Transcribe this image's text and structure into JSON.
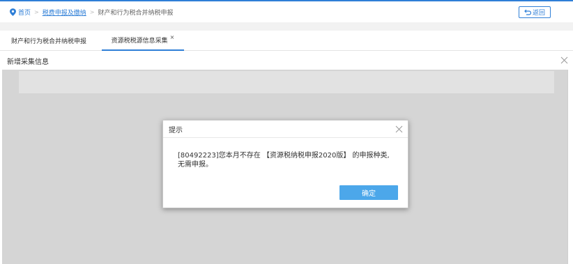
{
  "breadcrumb": {
    "home": "首页",
    "link": "税费申报及缴纳",
    "current": "财产和行为税合并纳税申报",
    "separator": ">"
  },
  "back_button": {
    "label": "返回"
  },
  "tabs": [
    {
      "label": "财产和行为税合并纳税申报",
      "active": false
    },
    {
      "label": "资源税税源信息采集",
      "active": true,
      "close": "×"
    }
  ],
  "panel": {
    "title": "新增采集信息"
  },
  "dialog": {
    "title": "提示",
    "message_line1": "[80492223]您本月不存在 【资源税纳税申报2020版】 的申报种类,",
    "message_line2": "无需申报。",
    "ok_label": "确定"
  },
  "colors": {
    "accent": "#2f7fd7",
    "button": "#4ca7ea",
    "overlay": "#d5d5d5"
  },
  "icons": {
    "home": "location-pin-icon",
    "back": "return-arrow-icon",
    "close": "close-icon"
  }
}
